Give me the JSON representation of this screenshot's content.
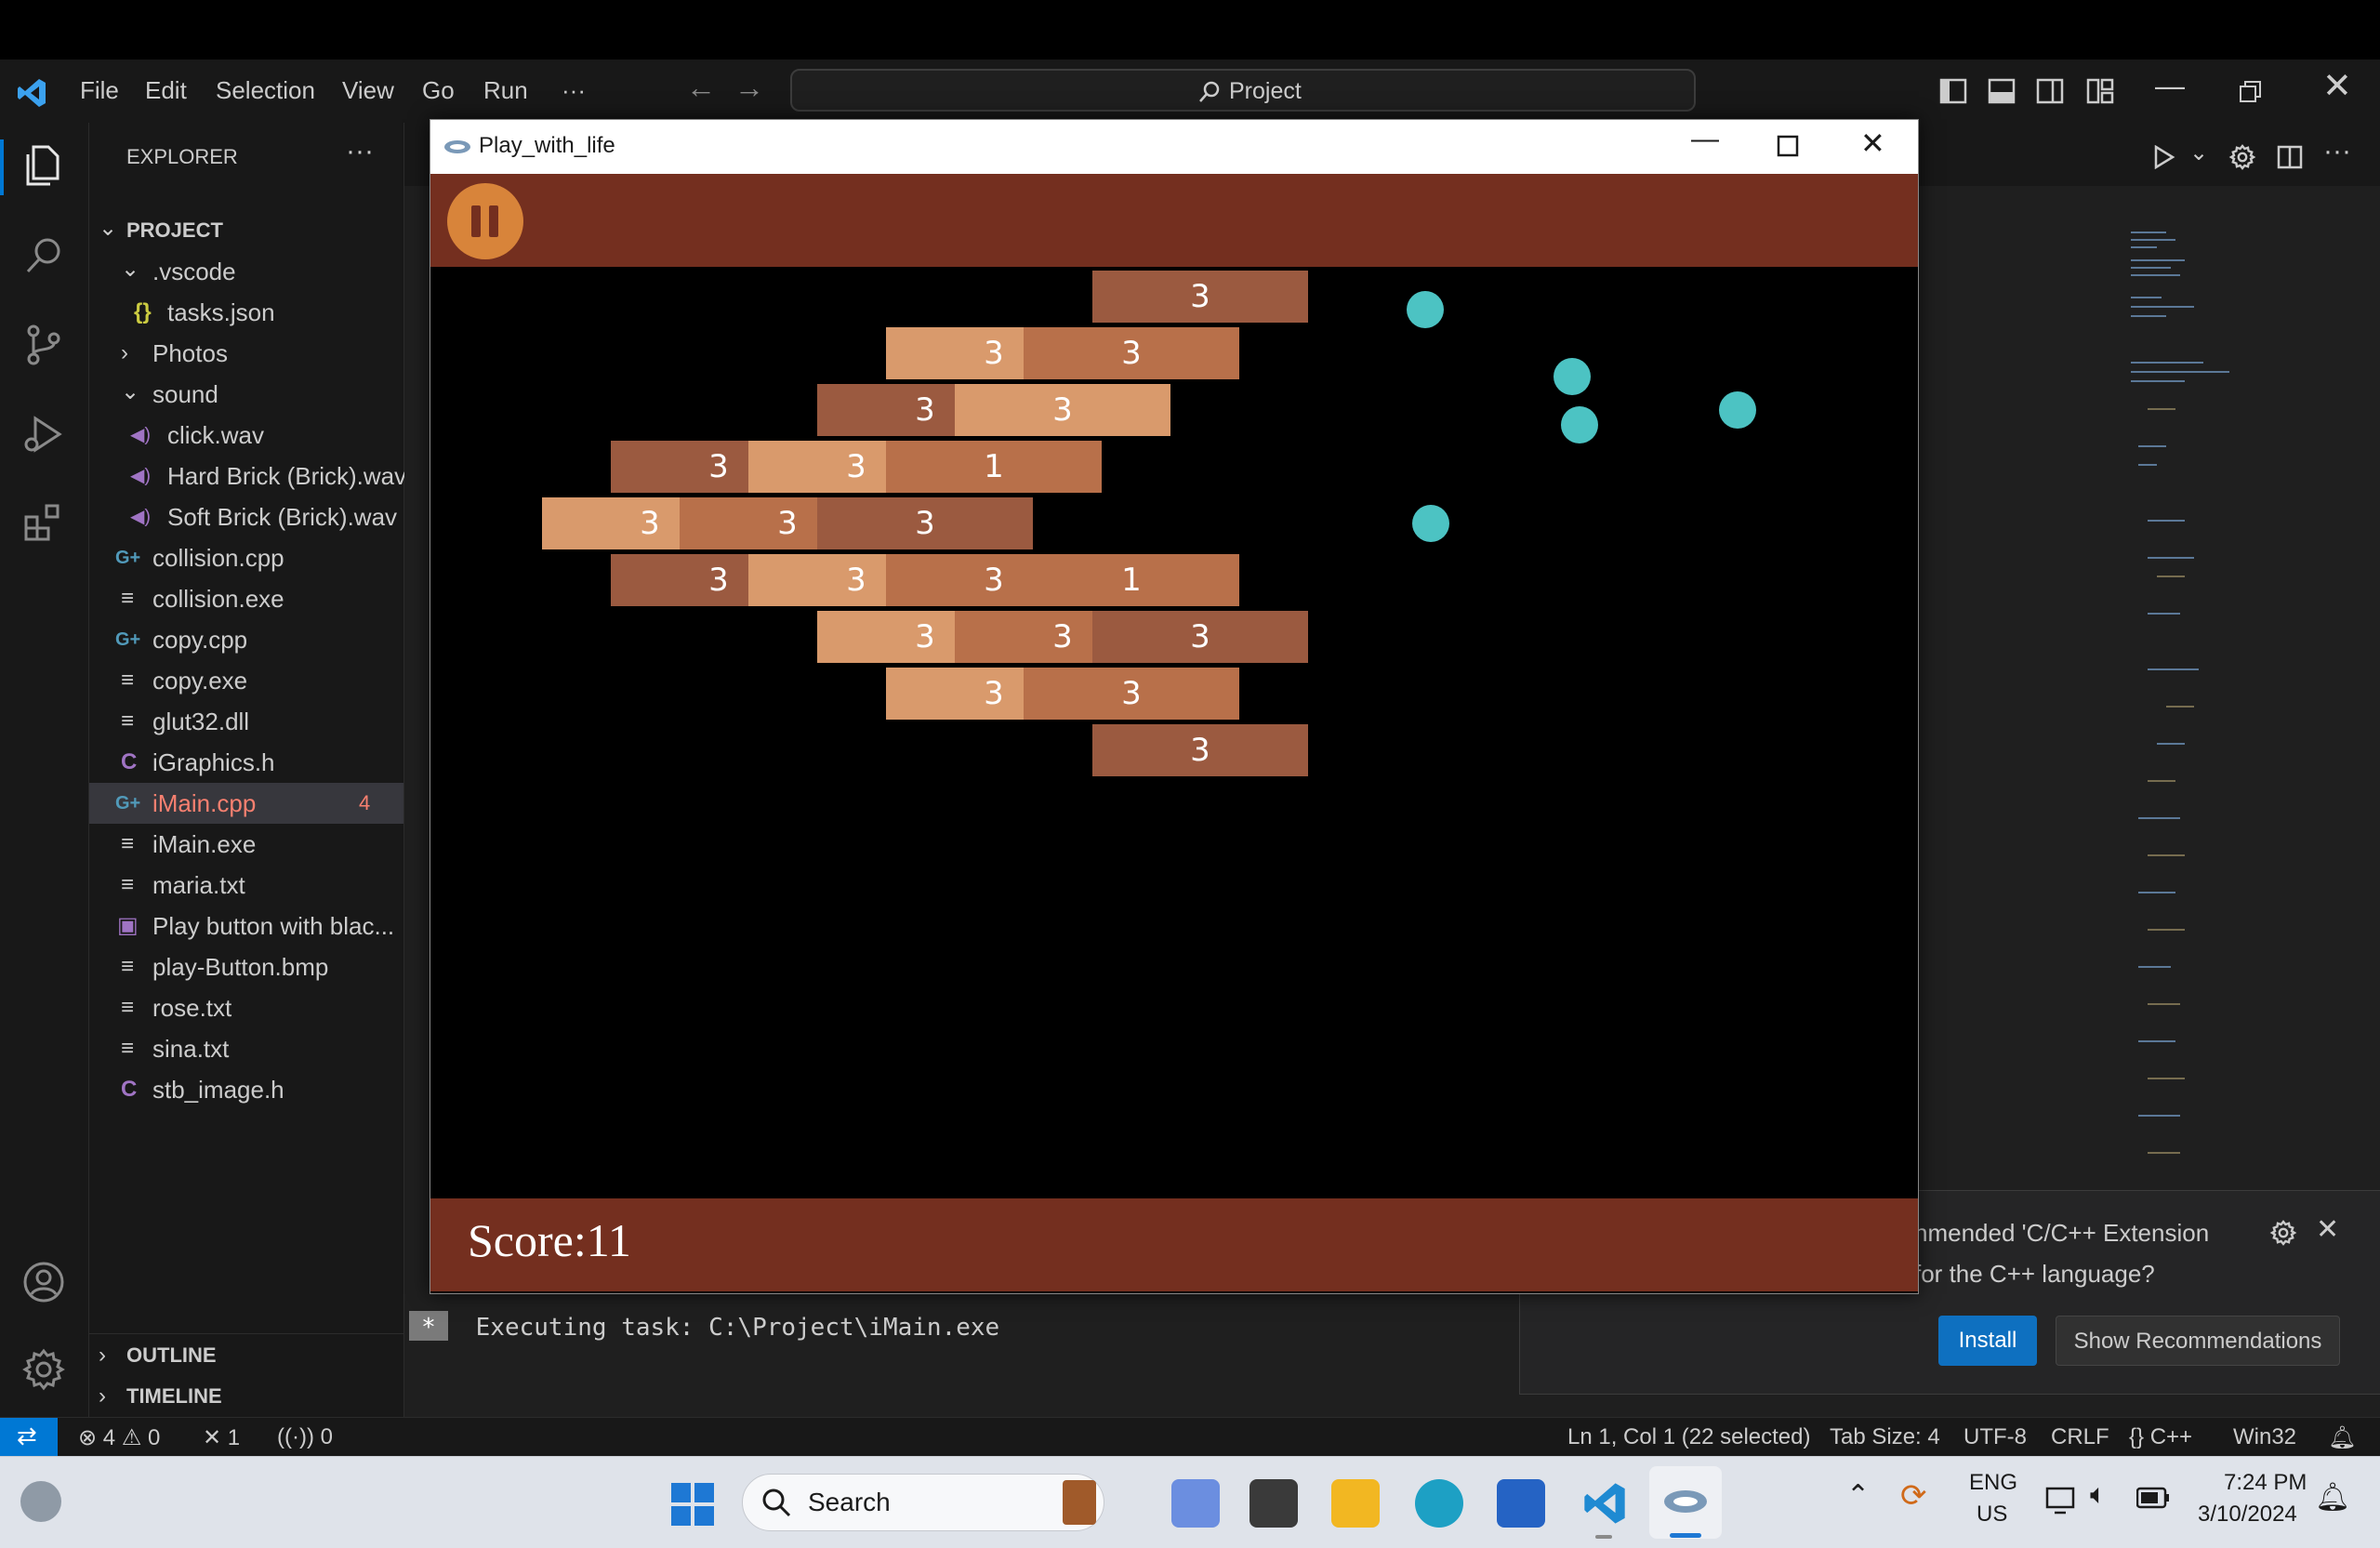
{
  "titlebar": {
    "menu": [
      "File",
      "Edit",
      "Selection",
      "View",
      "Go",
      "Run",
      "···"
    ],
    "search_text": "Project"
  },
  "sidebar": {
    "title": "EXPLORER",
    "more": "···",
    "section": "PROJECT",
    "items": [
      {
        "label": "tasks.json",
        "icon": "{}"
      },
      {
        "label": "Photos",
        "icon": ""
      },
      {
        "label": "sound",
        "icon": ""
      },
      {
        "label": "click.wav",
        "icon": "◀)"
      },
      {
        "label": "Hard Brick (Brick).wav",
        "icon": "◀)"
      },
      {
        "label": "Soft Brick (Brick).wav",
        "icon": "◀)"
      },
      {
        "label": "collision.cpp",
        "icon": "G+"
      },
      {
        "label": "collision.exe",
        "icon": "≡"
      },
      {
        "label": "copy.cpp",
        "icon": "G+"
      },
      {
        "label": "copy.exe",
        "icon": "≡"
      },
      {
        "label": "glut32.dll",
        "icon": "≡"
      },
      {
        "label": "iGraphics.h",
        "icon": "C"
      },
      {
        "label": "iMain.cpp",
        "icon": "G+",
        "badge": "4"
      },
      {
        "label": "iMain.exe",
        "icon": "≡"
      },
      {
        "label": "maria.txt",
        "icon": "≡"
      },
      {
        "label": "Play button with blac...",
        "icon": "▣"
      },
      {
        "label": "play-Button.bmp",
        "icon": "≡"
      },
      {
        "label": "rose.txt",
        "icon": "≡"
      },
      {
        "label": "sina.txt",
        "icon": "≡"
      },
      {
        "label": "stb_image.h",
        "icon": "C"
      }
    ],
    "vscode_folder": ".vscode",
    "outline": "OUTLINE",
    "timeline": "TIMELINE"
  },
  "game_window": {
    "title": "Play_with_life",
    "score_text": "Score:11",
    "bricks": [
      {
        "label": "3",
        "col": 3,
        "row": 0,
        "shade": "dark"
      },
      {
        "label": "3",
        "col": 2,
        "row": 1,
        "shade": "light"
      },
      {
        "label": "3",
        "col": 3,
        "row": 1,
        "shade": "mid"
      },
      {
        "label": "3",
        "col": 1,
        "row": 2,
        "shade": "dark"
      },
      {
        "label": "3",
        "col": 2,
        "row": 2,
        "shade": "light"
      },
      {
        "label": "3",
        "col": 0,
        "row": 3,
        "shade": "dark"
      },
      {
        "label": "3",
        "col": 1,
        "row": 3,
        "shade": "light"
      },
      {
        "label": "1",
        "col": 2,
        "row": 3,
        "shade": "mid"
      },
      {
        "label": "3",
        "col": -1,
        "row": 4,
        "shade": "light"
      },
      {
        "label": "3",
        "col": 0,
        "row": 4,
        "shade": "mid"
      },
      {
        "label": "3",
        "col": 1,
        "row": 4,
        "shade": "dark"
      },
      {
        "label": "3",
        "col": 0,
        "row": 5,
        "shade": "dark"
      },
      {
        "label": "3",
        "col": 1,
        "row": 5,
        "shade": "light"
      },
      {
        "label": "3",
        "col": 2,
        "row": 5,
        "shade": "mid"
      },
      {
        "label": "1",
        "col": 3,
        "row": 5,
        "shade": "mid"
      },
      {
        "label": "3",
        "col": 1,
        "row": 6,
        "shade": "light"
      },
      {
        "label": "3",
        "col": 2,
        "row": 6,
        "shade": "mid"
      },
      {
        "label": "3",
        "col": 3,
        "row": 6,
        "shade": "dark"
      },
      {
        "label": "3",
        "col": 2,
        "row": 7,
        "shade": "light"
      },
      {
        "label": "3",
        "col": 3,
        "row": 7,
        "shade": "mid"
      },
      {
        "label": "3",
        "col": 3,
        "row": 8,
        "shade": "dark"
      }
    ],
    "colors": {
      "dark": "#9b5a40",
      "mid": "#b8704a",
      "light": "#d99a6c",
      "bar": "#742f1f",
      "ball": "#4cc3c3",
      "pause": "#d8843a"
    }
  },
  "terminal": {
    "prefix": "*",
    "text": "Executing task: C:\\Project\\iMain.exe"
  },
  "notification": {
    "line1": "nmended 'C/C++ Extension",
    "line2": "for the C++ language?",
    "install": "Install",
    "show": "Show Recommendations"
  },
  "statusbar": {
    "errors": "4",
    "warnings": "0",
    "tools": "1",
    "ports": "0",
    "position": "Ln 1, Col 1 (22 selected)",
    "tabsize": "Tab Size: 4",
    "encoding": "UTF-8",
    "eol": "CRLF",
    "language": "C++",
    "platform": "Win32"
  },
  "taskbar": {
    "search": "Search",
    "lang1": "ENG",
    "lang2": "US",
    "time": "7:24 PM",
    "date": "3/10/2024"
  }
}
